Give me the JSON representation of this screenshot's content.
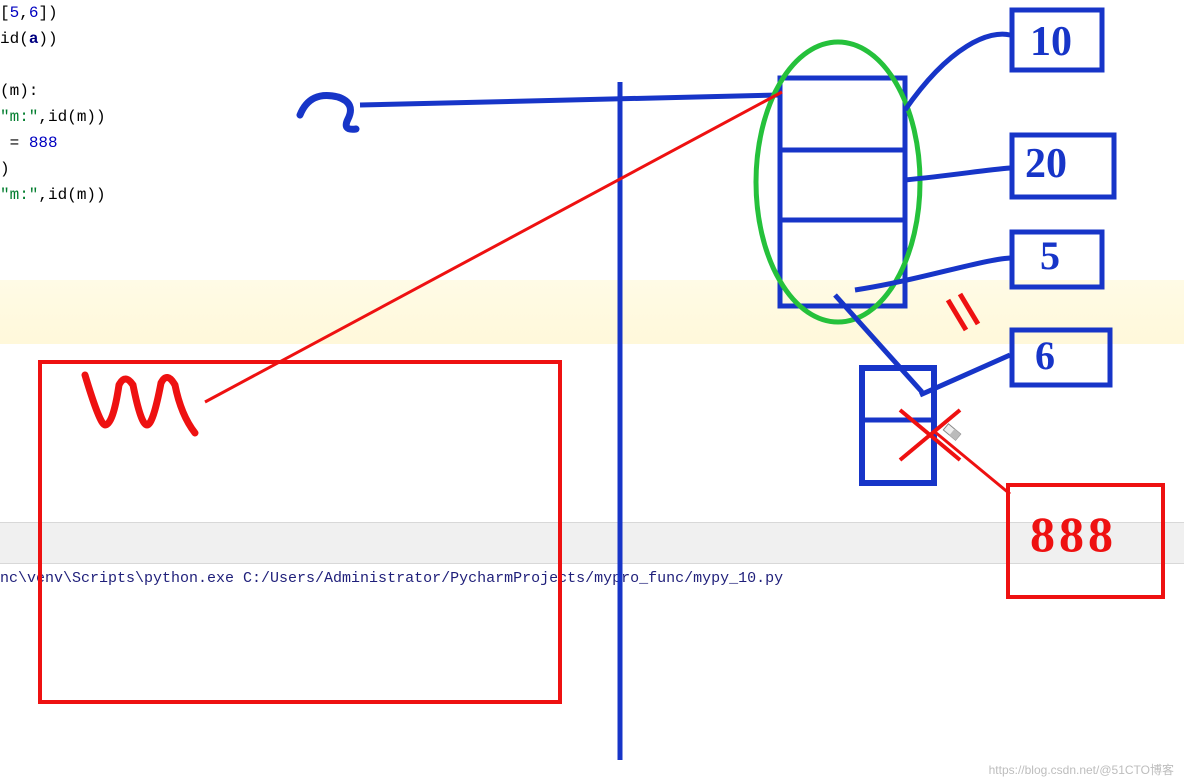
{
  "code": {
    "line1_a": "[",
    "line1_b": "5",
    "line1_c": ",",
    "line1_d": "6",
    "line1_e": "])",
    "line2_a": "id",
    "line2_b": "(",
    "line2_c": "a",
    "line2_d": "))",
    "line3_a": "(m):",
    "line4_a": "\"m:\"",
    "line4_b": ",id(m))",
    "line5_a": " = ",
    "line5_b": "888",
    "line6_a": ")",
    "line7_a": "\"m:\"",
    "line7_b": ",id(m))"
  },
  "console": {
    "line": "nc\\venv\\Scripts\\python.exe C:/Users/Administrator/PycharmProjects/mypro_func/mypy_10.py"
  },
  "annotations": {
    "a": "a",
    "m": "m",
    "v10": "10",
    "v20": "20",
    "v5": "5",
    "v6": "6",
    "v888": "888"
  },
  "watermark": "https://blog.csdn.net/@51CTO博客"
}
